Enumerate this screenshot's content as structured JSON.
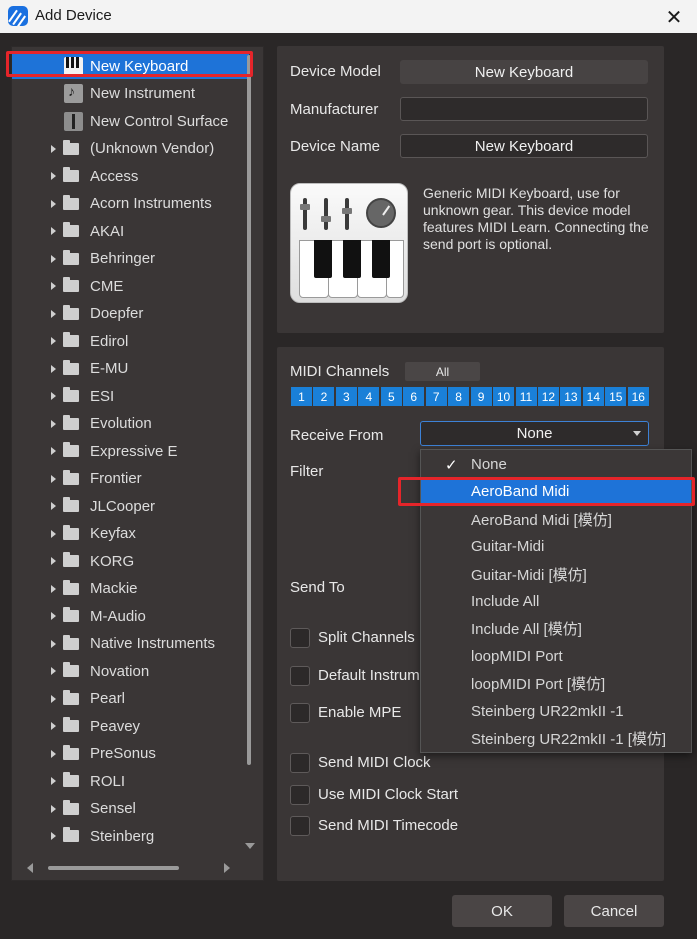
{
  "window": {
    "title": "Add Device",
    "close_glyph": "✕"
  },
  "tree": {
    "special_items": [
      {
        "label": "New Keyboard",
        "icon": "keyboard-icon",
        "selected": true
      },
      {
        "label": "New Instrument",
        "icon": "instrument-icon"
      },
      {
        "label": "New Control Surface",
        "icon": "control-surface-icon"
      }
    ],
    "vendors": [
      "(Unknown Vendor)",
      "Access",
      "Acorn Instruments",
      "AKAI",
      "Behringer",
      "CME",
      "Doepfer",
      "Edirol",
      "E-MU",
      "ESI",
      "Evolution",
      "Expressive E",
      "Frontier",
      "JLCooper",
      "Keyfax",
      "KORG",
      "Mackie",
      "M-Audio",
      "Native Instruments",
      "Novation",
      "Pearl",
      "Peavey",
      "PreSonus",
      "ROLI",
      "Sensel",
      "Steinberg"
    ]
  },
  "device": {
    "model_label": "Device Model",
    "model_value": "New Keyboard",
    "manufacturer_label": "Manufacturer",
    "manufacturer_value": "",
    "name_label": "Device Name",
    "name_value": "New Keyboard",
    "description": "Generic MIDI Keyboard, use for unknown gear. This device model features MIDI Learn. Connecting the send port is optional."
  },
  "midi": {
    "channels_label": "MIDI Channels",
    "all_label": "All",
    "channels": [
      "1",
      "2",
      "3",
      "4",
      "5",
      "6",
      "7",
      "8",
      "9",
      "10",
      "11",
      "12",
      "13",
      "14",
      "15",
      "16"
    ],
    "receive_label": "Receive From",
    "receive_value": "None",
    "filter_label": "Filter",
    "send_label": "Send To",
    "options": {
      "split_channels": "Split Channels",
      "default_instrument": "Default Instrum",
      "enable_mpe": "Enable MPE",
      "send_clock": "Send MIDI Clock",
      "use_clock_start": "Use MIDI Clock Start",
      "send_timecode": "Send MIDI Timecode"
    }
  },
  "dropdown": {
    "check_glyph": "✓",
    "items": [
      "None",
      "AeroBand Midi",
      "AeroBand Midi [模仿]",
      "Guitar-Midi",
      "Guitar-Midi [模仿]",
      "Include All",
      "Include All [模仿]",
      "loopMIDI Port",
      "loopMIDI Port [模仿]",
      "Steinberg UR22mkII -1",
      "Steinberg UR22mkII -1 [模仿]"
    ],
    "checked_index": 0,
    "highlighted_index": 1
  },
  "buttons": {
    "ok": "OK",
    "cancel": "Cancel"
  },
  "colors": {
    "accent": "#1e73d8",
    "highlight_outline": "#e5252a",
    "panel": "#3a3636",
    "background": "#2a2727"
  }
}
